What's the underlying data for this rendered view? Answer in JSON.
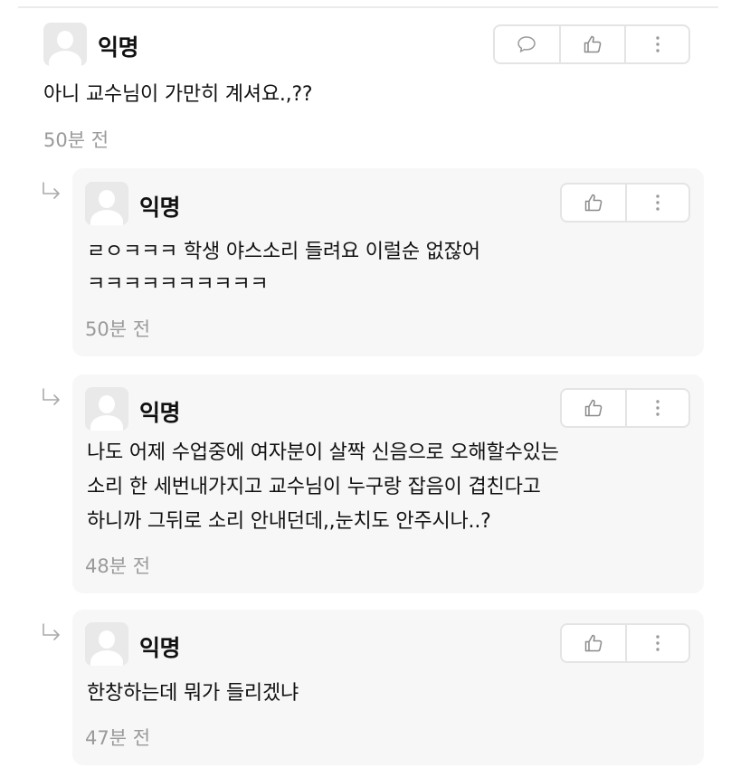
{
  "comments": [
    {
      "author": "익명",
      "text_lines": [
        "아니 교수님이 가만히 계셔요.,??"
      ],
      "time": "50분 전",
      "actions": [
        "comment-icon",
        "thumbs-up-icon",
        "more-vertical-icon"
      ]
    }
  ],
  "replies": [
    {
      "author": "익명",
      "text_lines": [
        "ㄹㅇㅋㅋㅋ 학생 야스소리 들려요 이럴순 없잖어",
        "ㅋㅋㅋㅋㅋㅋㅋㅋㅋㅋ"
      ],
      "time": "50분 전",
      "actions": [
        "thumbs-up-icon",
        "more-vertical-icon"
      ]
    },
    {
      "author": "익명",
      "text_lines": [
        "나도 어제 수업중에 여자분이 살짝 신음으로 오해할수있는",
        "소리 한 세번내가지고 교수님이 누구랑 잡음이 겹친다고",
        "하니까 그뒤로 소리 안내던데,,눈치도 안주시나..?"
      ],
      "time": "48분 전",
      "actions": [
        "thumbs-up-icon",
        "more-vertical-icon"
      ]
    },
    {
      "author": "익명",
      "text_lines": [
        "한창하는데 뭐가 들리겠냐"
      ],
      "time": "47분 전",
      "actions": [
        "thumbs-up-icon",
        "more-vertical-icon"
      ]
    }
  ],
  "colors": {
    "reply_background": "#f7f7f7",
    "time_text": "#9a9a9a",
    "border": "#e4e4e4",
    "avatar_background": "#e9e9e9"
  }
}
